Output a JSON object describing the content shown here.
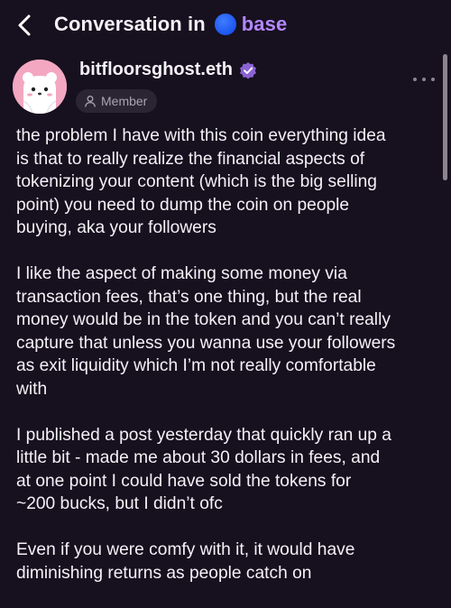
{
  "header": {
    "title": "Conversation in",
    "channel_name": "base",
    "back_icon": "chevron-left-icon",
    "channel_icon": "base-channel-dot"
  },
  "author": {
    "username": "bitfloorsghost.eth",
    "verified_icon": "verified-badge-icon",
    "role_badge": "Member",
    "role_icon": "person-icon",
    "avatar_icon": "ghost-bear-avatar"
  },
  "post": {
    "paragraphs": [
      "the problem I have with this coin everything idea\nis that to really realize the financial aspects of\ntokenizing your content (which is the big selling\npoint) you need to dump the coin on people\nbuying, aka your followers",
      "I like the aspect of making some money via\ntransaction fees, that’s one thing, but the real\nmoney would be in the token and you can’t really\ncapture that unless you wanna use your followers\nas exit liquidity which I’m not really comfortable\nwith",
      "I published a post yesterday that quickly ran up a\nlittle bit - made me about 30 dollars in fees, and\nat one point I could have sold the tokens for\n~200 bucks, but I didn’t ofc",
      "Even if you were comfy with it, it would have\ndiminishing returns as people catch on"
    ]
  },
  "colors": {
    "background": "#17101f",
    "accent_channel": "#b487ff",
    "channel_dot": "#1c56f0",
    "verified": "#8a63d2",
    "avatar_bg": "#f4a7c0"
  }
}
